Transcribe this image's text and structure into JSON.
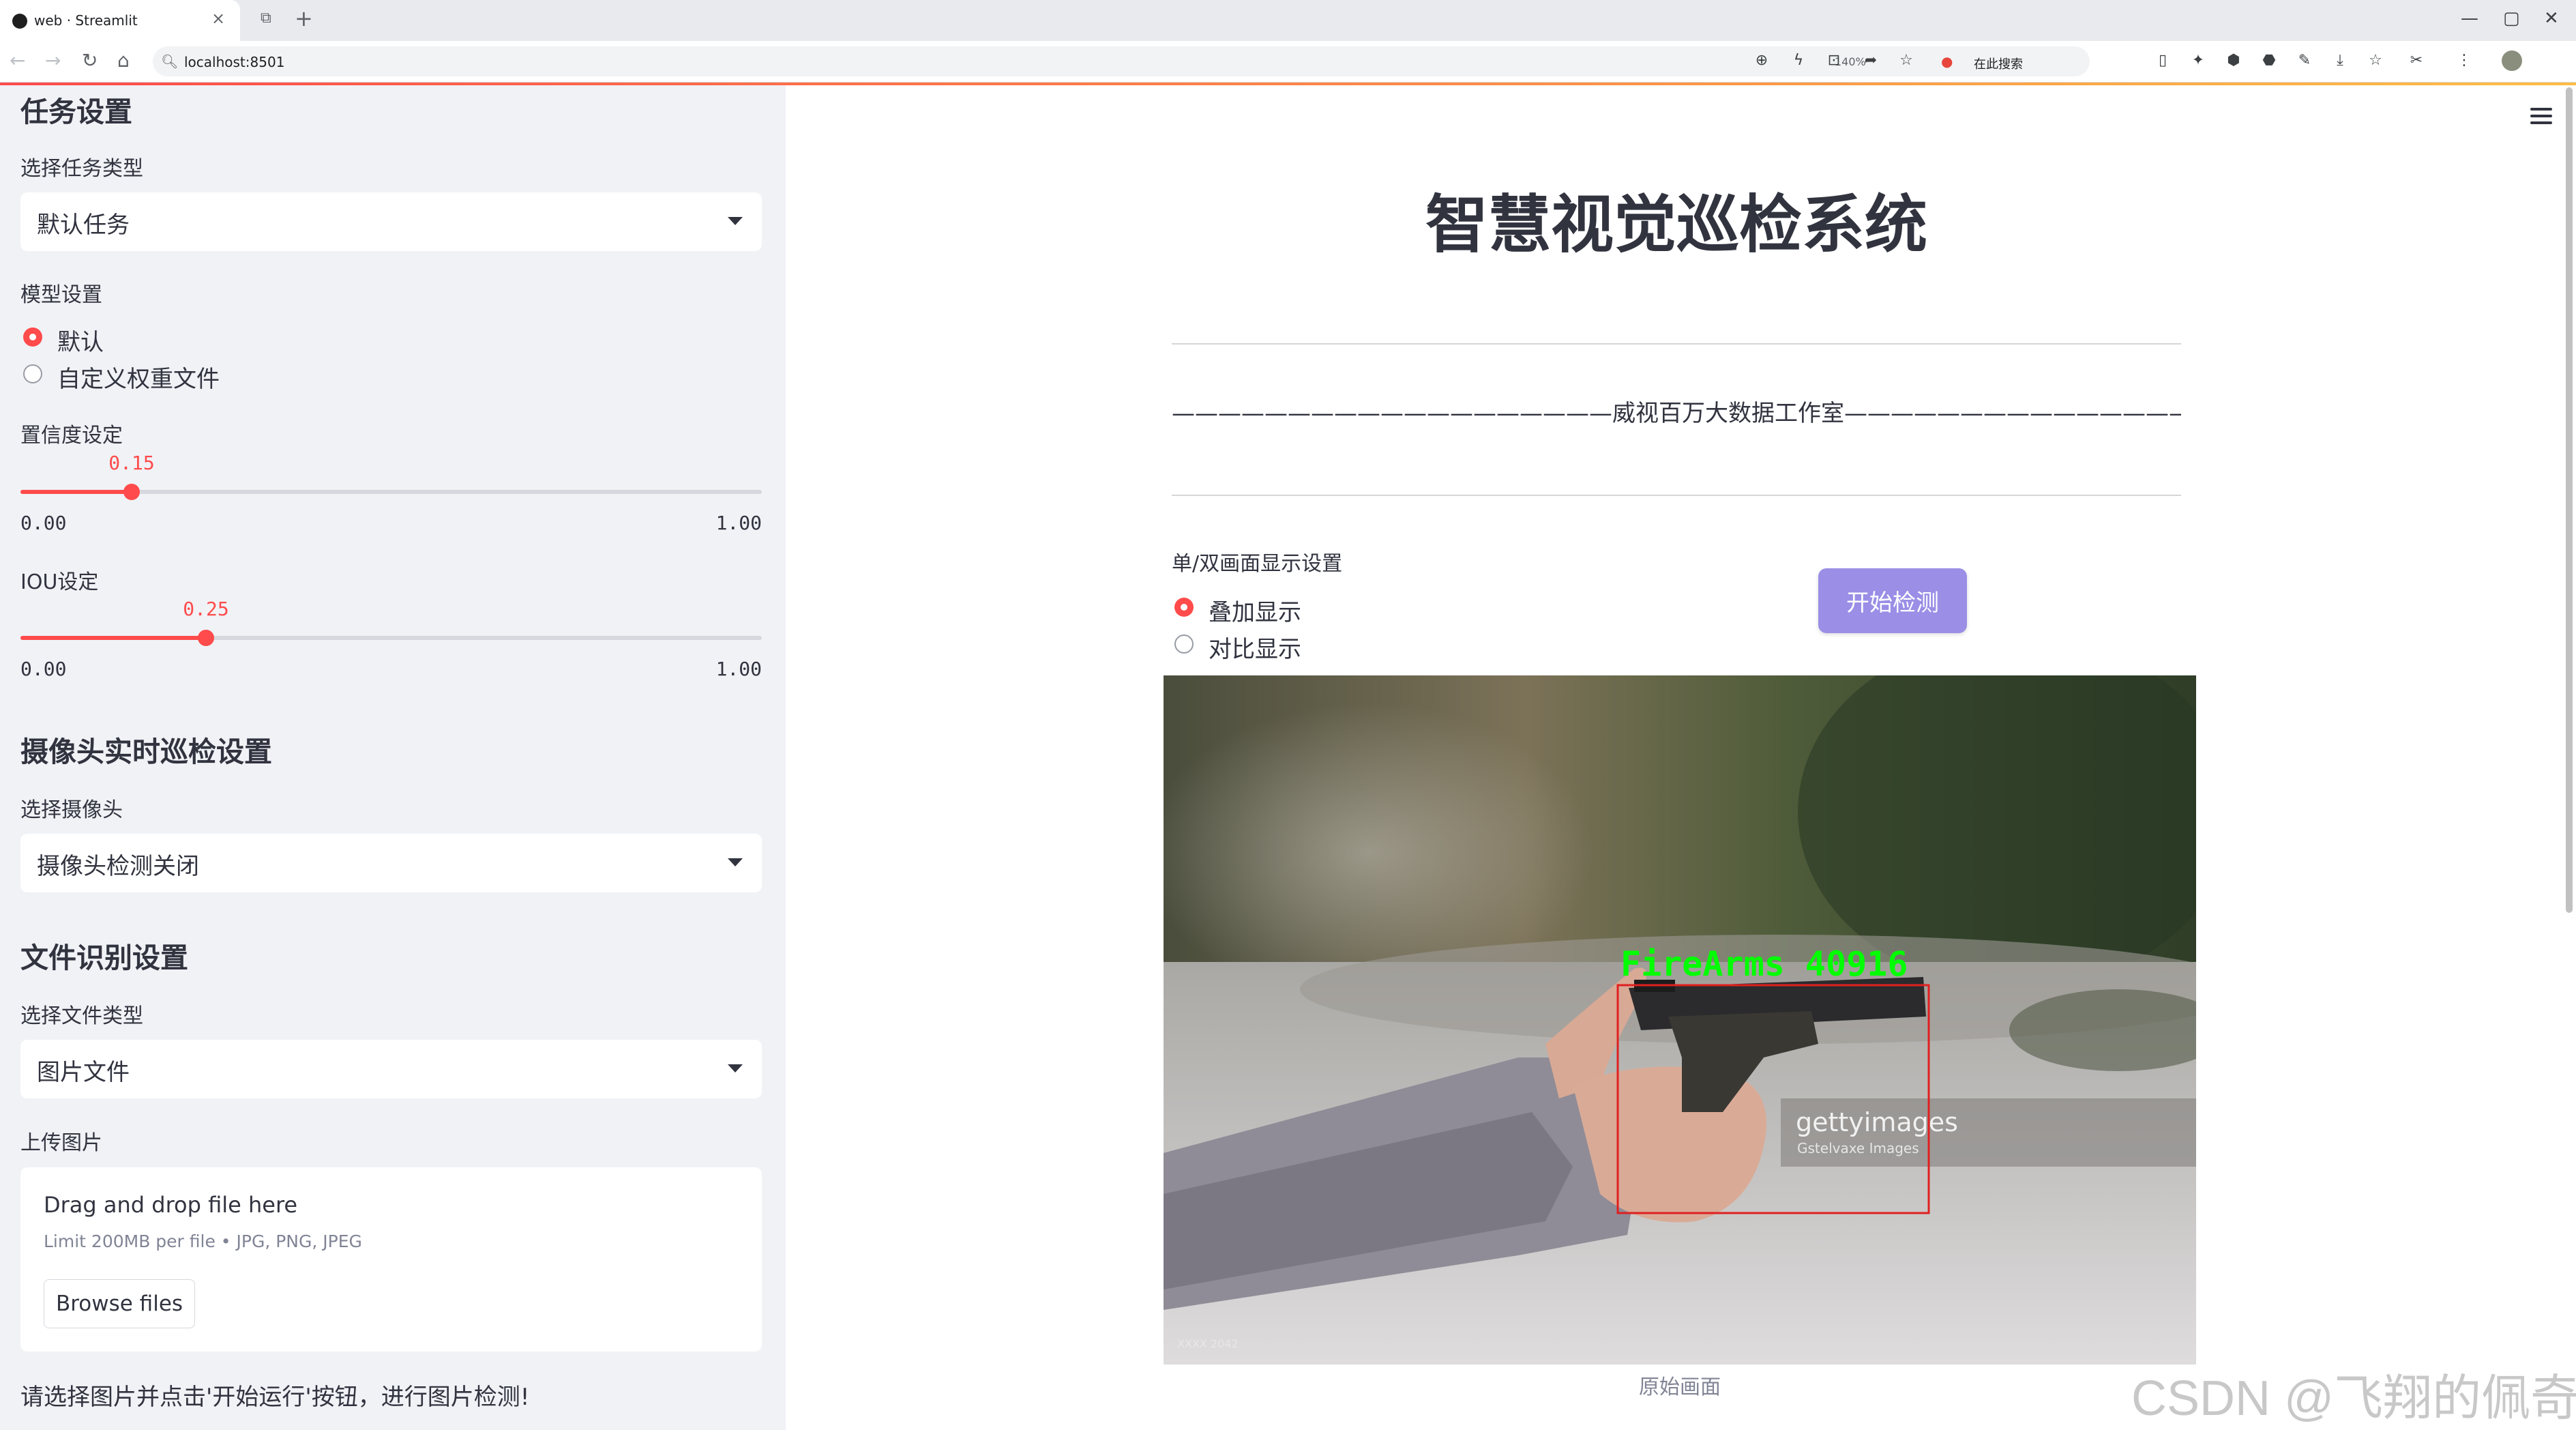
{
  "browser": {
    "tab_title": "web · Streamlit",
    "tab_close": "×",
    "new_tab": "+",
    "url": "localhost:8501",
    "zoom": "140%",
    "search_label": "在此搜索",
    "window_controls": [
      "—",
      "▢",
      "✕"
    ],
    "toolbar_glyphs": [
      "←",
      "→",
      "↻",
      "⌂"
    ],
    "extension_glyphs": [
      "⊕",
      "ϟ",
      "⊡",
      "➦",
      "☆",
      "▯",
      "✦",
      "⬢",
      "⬣",
      "✎",
      "⤓",
      "☆",
      "✂",
      "⋮"
    ],
    "extension_icons": [
      "translate-icon",
      "bolt-icon",
      "capture-icon",
      "share-icon",
      "bookmark-star-icon",
      "mobile-icon",
      "color-extension-icon",
      "extension-icon",
      "extension-icon",
      "sync-icon",
      "download-icon",
      "favorites-icon",
      "screenshot-icon",
      "more-icon"
    ]
  },
  "sidebar": {
    "task_heading": "任务设置",
    "task_type_label": "选择任务类型",
    "task_type_value": "默认任务",
    "model_label": "模型设置",
    "model_options": [
      "默认",
      "自定义权重文件"
    ],
    "model_selected": 0,
    "conf_label": "置信度设定",
    "conf_value": "0.15",
    "conf_min": "0.00",
    "conf_max": "1.00",
    "iou_label": "IOU设定",
    "iou_value": "0.25",
    "iou_min": "0.00",
    "iou_max": "1.00",
    "camera_heading": "摄像头实时巡检设置",
    "camera_label": "选择摄像头",
    "camera_value": "摄像头检测关闭",
    "file_heading": "文件识别设置",
    "file_type_label": "选择文件类型",
    "file_type_value": "图片文件",
    "upload_label": "上传图片",
    "upload_drop": "Drag and drop file here",
    "upload_limit": "Limit 200MB per file • JPG, PNG, JPEG",
    "browse_label": "Browse files",
    "hint": "请选择图片并点击'开始运行'按钮，进行图片检测!"
  },
  "main": {
    "title": "智慧视觉巡检系统",
    "subtitle": "———————————————————威视百万大数据工作室————————————————————",
    "mode_label": "单/双画面显示设置",
    "mode_options": [
      "叠加显示",
      "对比显示"
    ],
    "mode_selected": 0,
    "start_button": "开始检测",
    "detection_label": "FireArms  40916",
    "photo_watermark": "gettyimages",
    "photo_watermark_sub": "Gstelvaxe Images",
    "photo_corner": "XXXX 2042",
    "caption": "原始画面"
  },
  "page_watermark": "CSDN @飞翔的佩奇",
  "colors": {
    "accent": "#ff4b4b",
    "button": "#9a8ee6",
    "sidebar_bg": "#f0f2f6",
    "detection_box": "#e02020",
    "detection_text": "#00ff00"
  }
}
